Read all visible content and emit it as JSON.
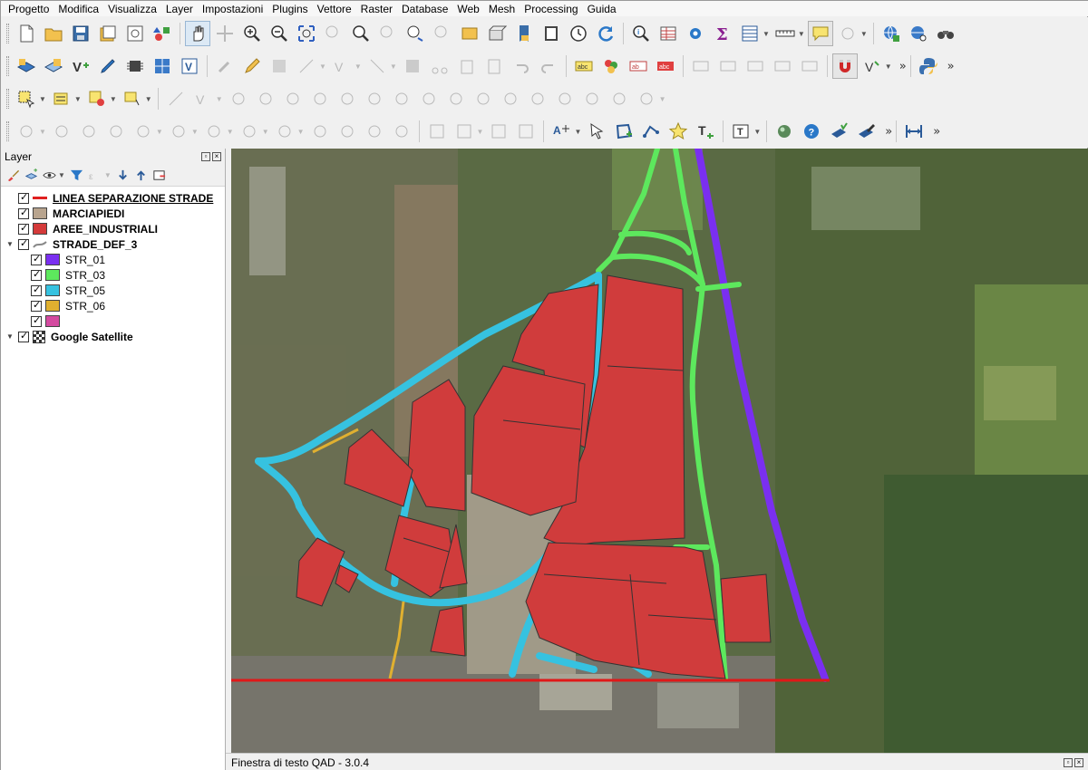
{
  "menu": [
    "Progetto",
    "Modifica",
    "Visualizza",
    "Layer",
    "Impostazioni",
    "Plugins",
    "Vettore",
    "Raster",
    "Database",
    "Web",
    "Mesh",
    "Processing",
    "Guida"
  ],
  "layer_panel": {
    "title": "Layer",
    "layers": [
      {
        "name": "LINEA SEPARAZIONE STRADE",
        "symbol": "line",
        "color": "#e02020"
      },
      {
        "name": "MARCIAPIEDI",
        "symbol": "fill",
        "color": "#b8a48e"
      },
      {
        "name": "AREE_INDUSTRIALI",
        "symbol": "fill",
        "color": "#d43a3a"
      },
      {
        "name": "STRADE_DEF_3",
        "symbol": "group"
      },
      {
        "name": "STR_01",
        "color": "#7a2ff0"
      },
      {
        "name": "STR_03",
        "color": "#5de85d"
      },
      {
        "name": "STR_05",
        "color": "#36c2e0"
      },
      {
        "name": "STR_06",
        "color": "#e0b030"
      },
      {
        "name": "",
        "color": "#d44aa0"
      },
      {
        "name": "Google Satellite",
        "symbol": "raster"
      }
    ]
  },
  "map_colors": {
    "industrial": "#d03c3c",
    "str_01": "#7a2ff0",
    "str_03": "#5de85d",
    "str_05": "#36c2e0",
    "str_06": "#e0b030",
    "separation": "#e01818"
  },
  "status": {
    "text": "Finestra di testo QAD - 3.0.4"
  },
  "icons": [
    "new-icon",
    "open-icon",
    "save-icon",
    "pan-icon",
    "zoom-in-icon",
    "zoom-out-icon",
    "refresh-icon",
    "identify-icon",
    "sum-icon",
    "python-icon",
    "help-icon",
    "magnet-icon"
  ]
}
